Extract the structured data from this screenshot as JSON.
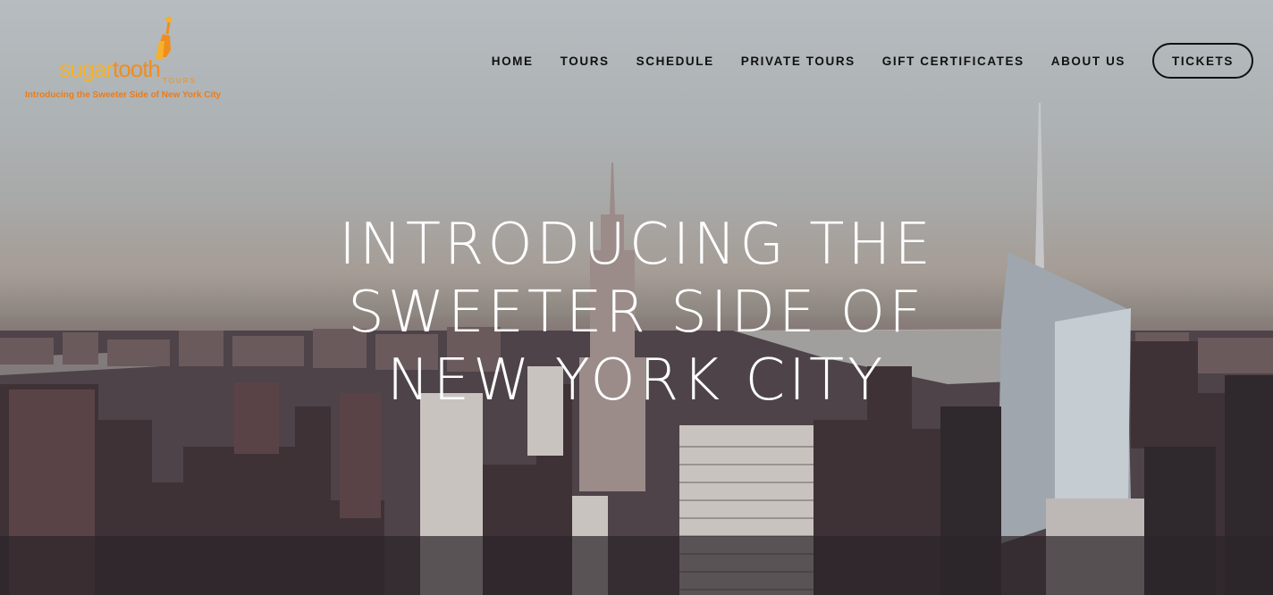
{
  "brand": {
    "word_part1": "sugar",
    "word_part2": "tooth",
    "sub": "TOURS",
    "tagline": "Introducing the Sweeter Side of New York City",
    "colors": {
      "sugar": "#f6b12a",
      "tooth": "#f08d1f",
      "tagline": "#ef7b17"
    }
  },
  "nav": {
    "items": [
      {
        "label": "HOME"
      },
      {
        "label": "TOURS"
      },
      {
        "label": "SCHEDULE"
      },
      {
        "label": "PRIVATE TOURS"
      },
      {
        "label": "GIFT CERTIFICATES"
      },
      {
        "label": "ABOUT US"
      }
    ],
    "cta": "TICKETS"
  },
  "hero": {
    "lines": [
      "INTRODUCING THE",
      "SWEETER SIDE OF",
      "NEW YORK CITY"
    ],
    "background": "new-york-skyline-photo"
  }
}
